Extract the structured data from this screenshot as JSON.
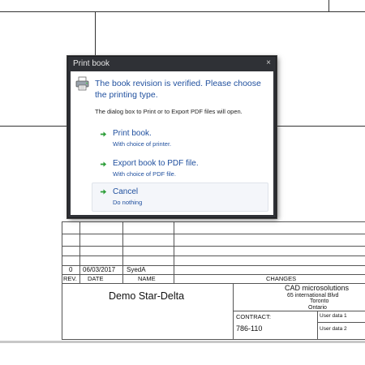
{
  "dialog": {
    "title": "Print book",
    "close_glyph": "×",
    "icon": "printer-icon",
    "heading": "The book revision is verified. Please choose the printing type.",
    "subtext": "The dialog box to Print or to Export PDF files will open.",
    "options": [
      {
        "label": "Print book.",
        "desc": "With choice of printer.",
        "icon": "green-arrow-icon"
      },
      {
        "label": "Export book to PDF file.",
        "desc": "With choice of PDF file.",
        "icon": "green-arrow-icon"
      },
      {
        "label": "Cancel",
        "desc": "Do nothing",
        "icon": "green-arrow-icon"
      }
    ]
  },
  "title_block": {
    "revision_row": {
      "rev": "0",
      "date": "06/03/2017",
      "name": "SyedA"
    },
    "headers": {
      "rev": "REV.",
      "date": "DATE",
      "name": "NAME",
      "changes": "CHANGES"
    },
    "drawing_title": "Demo Star-Delta",
    "company": {
      "name": "CAD microsolutions",
      "address1": "65 international Blvd",
      "city": "Toronto",
      "province": "Ontario"
    },
    "contract_label": "CONTRACT:",
    "contract_value": "786-110",
    "user_data_1": "User data 1",
    "user_data_2": "User data 2"
  },
  "colors": {
    "accent": "#1f4f9e",
    "arrow": "#2e9e3a",
    "dialog_frame": "#2f3136"
  }
}
